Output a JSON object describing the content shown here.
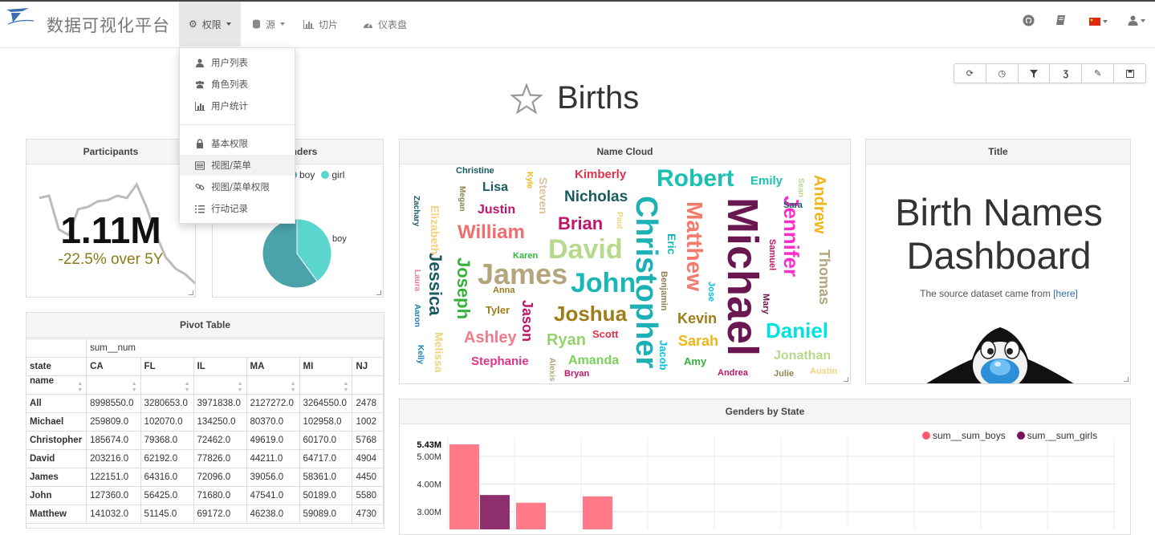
{
  "navbar": {
    "brand": "数据可视化平台",
    "items": [
      {
        "label": "权限",
        "icon": "gears-icon",
        "active": true
      },
      {
        "label": "源",
        "icon": "database-icon"
      },
      {
        "label": "切片",
        "icon": "bar-chart-icon"
      },
      {
        "label": "仪表盘",
        "icon": "dashboard-icon"
      }
    ],
    "right_icons": [
      "github-icon",
      "book-icon",
      "flag-cn-icon",
      "user-icon"
    ]
  },
  "dropdown": {
    "items": [
      {
        "label": "用户列表",
        "icon": "user-icon"
      },
      {
        "label": "角色列表",
        "icon": "users-icon"
      },
      {
        "label": "用户统计",
        "icon": "bar-chart-icon"
      },
      {
        "label": "基本权限",
        "icon": "lock-icon"
      },
      {
        "label": "视图/菜单",
        "icon": "list-alt-icon",
        "highlighted": true
      },
      {
        "label": "视图/菜单权限",
        "icon": "link-icon"
      },
      {
        "label": "行动记录",
        "icon": "list-ol-icon"
      }
    ]
  },
  "toolbar": {
    "buttons": [
      "refresh-icon",
      "clock-icon",
      "filter-icon",
      "css-icon",
      "edit-icon",
      "save-icon"
    ]
  },
  "dashboard": {
    "title": "Births",
    "star_icon": "star-icon"
  },
  "participants": {
    "title": "Participants",
    "value": "1.11M",
    "change": "-22.5% over 5Y",
    "change_color": "#8b7a1b",
    "trendline": [
      0.22,
      0.2,
      0.5,
      0.55,
      0.32,
      0.3,
      0.25,
      0.24,
      0.2,
      0.22,
      0.1,
      0.3,
      0.55,
      0.75,
      0.85,
      0.9,
      0.98
    ]
  },
  "genders": {
    "title": "Genders",
    "legend": [
      {
        "name": "boy",
        "color": "#4aa3ab"
      },
      {
        "name": "girl",
        "color": "#5ad6cf"
      }
    ],
    "slice_label": "boy",
    "chart_data": {
      "type": "pie",
      "categories": [
        "boy",
        "girl"
      ],
      "values": [
        0.6,
        0.4
      ]
    }
  },
  "name_cloud": {
    "title": "Name Cloud",
    "words": [
      {
        "text": "Michael",
        "color": "#6a1650",
        "size": 54,
        "vertical": true
      },
      {
        "text": "Christopher",
        "color": "#1cb2b5",
        "size": 38,
        "vertical": true
      },
      {
        "text": "David",
        "color": "#b7d98b",
        "size": 34
      },
      {
        "text": "James",
        "color": "#b5a57d",
        "size": 36
      },
      {
        "text": "John",
        "color": "#18b6b6",
        "size": 34
      },
      {
        "text": "Robert",
        "color": "#1ac0b0",
        "size": 30
      },
      {
        "text": "Matthew",
        "color": "#f27b6b",
        "size": 28,
        "vertical": true
      },
      {
        "text": "Jennifer",
        "color": "#ff2dcb",
        "size": 26,
        "vertical": true
      },
      {
        "text": "Daniel",
        "color": "#00e3e0",
        "size": 26
      },
      {
        "text": "Joshua",
        "color": "#9e7c16",
        "size": 26
      },
      {
        "text": "William",
        "color": "#f26c6c",
        "size": 24
      },
      {
        "text": "Brian",
        "color": "#c1156c",
        "size": 22
      },
      {
        "text": "Joseph",
        "color": "#35b13a",
        "size": 22,
        "vertical": true
      },
      {
        "text": "Jessica",
        "color": "#195a61",
        "size": 22,
        "vertical": true
      },
      {
        "text": "Nicholas",
        "color": "#195a61",
        "size": 19
      },
      {
        "text": "Andrew",
        "color": "#f2b516",
        "size": 20,
        "vertical": true
      },
      {
        "text": "Thomas",
        "color": "#b5a57d",
        "size": 18,
        "vertical": true
      },
      {
        "text": "Ashley",
        "color": "#f27b8b",
        "size": 20
      },
      {
        "text": "Ryan",
        "color": "#97d16f",
        "size": 20
      },
      {
        "text": "Amanda",
        "color": "#7ad15a",
        "size": 16
      },
      {
        "text": "Kevin",
        "color": "#9e7c16",
        "size": 18
      },
      {
        "text": "Sarah",
        "color": "#f2b516",
        "size": 18
      },
      {
        "text": "Jonathan",
        "color": "#b7d98b",
        "size": 16
      },
      {
        "text": "Kimberly",
        "color": "#e0334a",
        "size": 15
      },
      {
        "text": "Emily",
        "color": "#1ac0b0",
        "size": 15
      },
      {
        "text": "Justin",
        "color": "#c1156c",
        "size": 16
      },
      {
        "text": "Lisa",
        "color": "#195a61",
        "size": 16
      },
      {
        "text": "Stephanie",
        "color": "#e0338a",
        "size": 15
      },
      {
        "text": "Jason",
        "color": "#c1156c",
        "size": 18,
        "vertical": true
      },
      {
        "text": "Elizabeth",
        "color": "#f2d27b",
        "size": 14,
        "vertical": true
      },
      {
        "text": "Melissa",
        "color": "#f2d27b",
        "size": 14,
        "vertical": true
      },
      {
        "text": "Steven",
        "color": "#d9c39a",
        "size": 14,
        "vertical": true
      },
      {
        "text": "Eric",
        "color": "#18b6b6",
        "size": 14,
        "vertical": true
      },
      {
        "text": "Jacob",
        "color": "#00c2e0",
        "size": 13,
        "vertical": true
      },
      {
        "text": "Tyler",
        "color": "#9e7c16",
        "size": 13
      },
      {
        "text": "Scott",
        "color": "#e0334a",
        "size": 13
      },
      {
        "text": "Amy",
        "color": "#35b13a",
        "size": 13
      },
      {
        "text": "Andrea",
        "color": "#c1156c",
        "size": 11
      },
      {
        "text": "Julie",
        "color": "#8b8450",
        "size": 11
      },
      {
        "text": "Austin",
        "color": "#f2d27b",
        "size": 11
      },
      {
        "text": "Christine",
        "color": "#195a61",
        "size": 11
      },
      {
        "text": "Karen",
        "color": "#35b13a",
        "size": 11
      },
      {
        "text": "Anna",
        "color": "#9e7c16",
        "size": 11
      },
      {
        "text": "Bryan",
        "color": "#c1156c",
        "size": 11
      },
      {
        "text": "Benjamin",
        "color": "#8b8450",
        "size": 11,
        "vertical": true
      },
      {
        "text": "Samuel",
        "color": "#c1156c",
        "size": 11,
        "vertical": true
      },
      {
        "text": "Mary",
        "color": "#6a1650",
        "size": 11,
        "vertical": true
      },
      {
        "text": "Jose",
        "color": "#00c2e0",
        "size": 11,
        "vertical": true
      },
      {
        "text": "Sara",
        "color": "#195a61",
        "size": 11
      },
      {
        "text": "Sean",
        "color": "#b7d98b",
        "size": 10,
        "vertical": true
      },
      {
        "text": "Paul",
        "color": "#f2d27b",
        "size": 10,
        "vertical": true
      },
      {
        "text": "Kyle",
        "color": "#f2b516",
        "size": 10,
        "vertical": true
      },
      {
        "text": "Megan",
        "color": "#8b8450",
        "size": 10,
        "vertical": true
      },
      {
        "text": "Zachary",
        "color": "#195a61",
        "size": 10,
        "vertical": true
      },
      {
        "text": "Laura",
        "color": "#f27b8b",
        "size": 10,
        "vertical": true
      },
      {
        "text": "Aaron",
        "color": "#1a7fb5",
        "size": 10,
        "vertical": true
      },
      {
        "text": "Kelly",
        "color": "#1a7fb5",
        "size": 10,
        "vertical": true
      },
      {
        "text": "Alexis",
        "color": "#b5a57d",
        "size": 10,
        "vertical": true
      }
    ]
  },
  "markdown": {
    "title": "Title",
    "heading": "Birth Names Dashboard",
    "source_text": "The source dataset came from ",
    "source_link": "[here]",
    "image_icon": "tux-penguin-icon"
  },
  "pivot": {
    "title": "Pivot Table",
    "metric": "sum__num",
    "row_header_state": "state",
    "row_header_name": "name",
    "columns": [
      "CA",
      "FL",
      "IL",
      "MA",
      "MI",
      "NJ"
    ],
    "rows": [
      {
        "name": "All",
        "values": [
          "8998550.0",
          "3280653.0",
          "3971838.0",
          "2127272.0",
          "3264550.0",
          "2478"
        ]
      },
      {
        "name": "Michael",
        "values": [
          "259809.0",
          "102070.0",
          "134250.0",
          "80370.0",
          "102958.0",
          "1002"
        ]
      },
      {
        "name": "Christopher",
        "values": [
          "185674.0",
          "79368.0",
          "72462.0",
          "49619.0",
          "60170.0",
          "5768"
        ]
      },
      {
        "name": "David",
        "values": [
          "203216.0",
          "62192.0",
          "77826.0",
          "44211.0",
          "64717.0",
          "4904"
        ]
      },
      {
        "name": "James",
        "values": [
          "122151.0",
          "64316.0",
          "72096.0",
          "39056.0",
          "58361.0",
          "4450"
        ]
      },
      {
        "name": "John",
        "values": [
          "127360.0",
          "56425.0",
          "71680.0",
          "47541.0",
          "50189.0",
          "5580"
        ]
      },
      {
        "name": "Matthew",
        "values": [
          "141032.0",
          "51145.0",
          "69172.0",
          "46238.0",
          "59089.0",
          "4730"
        ]
      }
    ]
  },
  "genders_by_state": {
    "title": "Genders by State",
    "legend": [
      {
        "name": "sum__sum_boys",
        "color": "#ff5a6e"
      },
      {
        "name": "sum__sum_girls",
        "color": "#7b1158"
      }
    ],
    "max_label": "5.43M",
    "y_ticks": [
      "5.00M",
      "4.00M",
      "3.00M"
    ],
    "chart_data": {
      "type": "bar",
      "series": [
        {
          "name": "sum__sum_boys",
          "values": [
            5.43,
            3.32,
            3.55
          ]
        },
        {
          "name": "sum__sum_girls",
          "values": [
            3.6
          ]
        }
      ],
      "ylim": [
        2.6,
        5.43
      ]
    }
  }
}
